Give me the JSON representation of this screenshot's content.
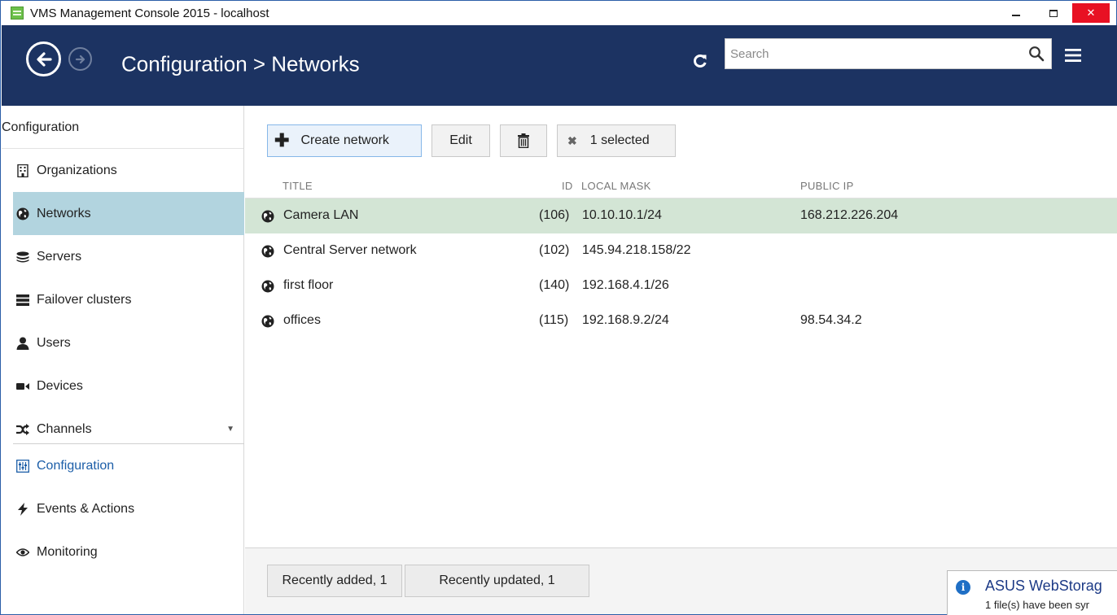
{
  "window": {
    "title": "VMS Management Console 2015 - localhost",
    "controls": {
      "minimize": "–",
      "maximize": "□",
      "close": "✕"
    }
  },
  "header": {
    "breadcrumb": "Configuration > Networks",
    "search": {
      "placeholder": "Search",
      "value": ""
    },
    "icons": [
      "back-icon",
      "forward-icon",
      "refresh-icon",
      "search-icon",
      "menu-icon"
    ]
  },
  "sidebar": {
    "heading": "Configuration",
    "items": [
      {
        "label": "Organizations",
        "icon": "building-icon",
        "active": false
      },
      {
        "label": "Networks",
        "icon": "globe-icon",
        "active": true
      },
      {
        "label": "Servers",
        "icon": "servers-icon",
        "active": false
      },
      {
        "label": "Failover clusters",
        "icon": "cluster-icon",
        "active": false
      },
      {
        "label": "Users",
        "icon": "user-icon",
        "active": false
      },
      {
        "label": "Devices",
        "icon": "camera-icon",
        "active": false
      },
      {
        "label": "Channels",
        "icon": "shuffle-icon",
        "active": false
      }
    ],
    "sections": [
      {
        "label": "Configuration",
        "icon": "sliders-icon",
        "active": true
      },
      {
        "label": "Events & Actions",
        "icon": "lightning-icon",
        "active": false
      },
      {
        "label": "Monitoring",
        "icon": "eye-icon",
        "active": false
      }
    ]
  },
  "toolbar": {
    "create_label": "Create network",
    "edit_label": "Edit",
    "selected_label": "1 selected"
  },
  "table": {
    "columns": {
      "title": "TITLE",
      "id": "ID",
      "local_mask": "LOCAL MASK",
      "public_ip": "PUBLIC IP"
    },
    "rows": [
      {
        "title": "Camera LAN",
        "id": "(106)",
        "local_mask": "10.10.10.1/24",
        "public_ip": "168.212.226.204",
        "selected": true
      },
      {
        "title": "Central Server network",
        "id": "(102)",
        "local_mask": "145.94.218.158/22",
        "public_ip": "",
        "selected": false
      },
      {
        "title": "first floor",
        "id": "(140)",
        "local_mask": "192.168.4.1/26",
        "public_ip": "",
        "selected": false
      },
      {
        "title": "offices",
        "id": "(115)",
        "local_mask": "192.168.9.2/24",
        "public_ip": "98.54.34.2",
        "selected": false
      }
    ]
  },
  "footer": {
    "recently_added": "Recently added, 1",
    "recently_updated": "Recently updated, 1"
  },
  "toast": {
    "title": "ASUS WebStorag",
    "body": "1 file(s) have been syr"
  },
  "colors": {
    "header_bg": "#1c3362",
    "sidebar_active": "#b2d4df",
    "row_selected": "#d3e5d5",
    "section_active_text": "#1c5ea8",
    "close_button": "#e81123"
  }
}
